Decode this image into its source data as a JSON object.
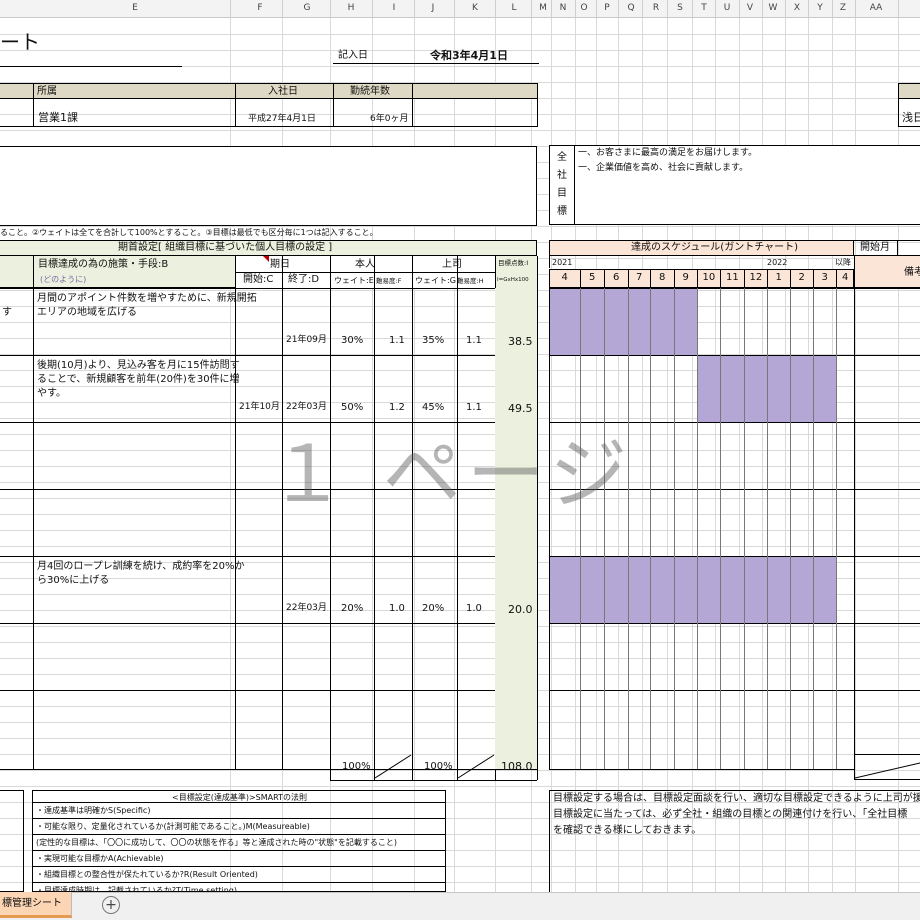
{
  "column_letters": [
    "E",
    "F",
    "G",
    "H",
    "I",
    "J",
    "K",
    "L",
    "M",
    "N",
    "O",
    "P",
    "Q",
    "R",
    "S",
    "T",
    "U",
    "V",
    "W",
    "X",
    "Y",
    "Z",
    "AA"
  ],
  "sheet": {
    "title_fragment": "ート",
    "entry_date_label": "記入日",
    "entry_date_value": "令和3年4月1日",
    "header": {
      "dept_label": "所属",
      "dept_value": "営業1課",
      "joined_label": "入社日",
      "joined_value": "平成27年4月1日",
      "tenure_label": "勤続年数",
      "tenure_value": "6年0ヶ月",
      "right_fragment": "浅日"
    },
    "company_goals": {
      "label_chars": [
        "全",
        "社",
        "目",
        "標"
      ],
      "lines": [
        "一、お客さまに最高の満足をお届けします。",
        "一、企業価値を高め、社会に貢献します。"
      ]
    },
    "notice": "ること。②ウェイトは全てを合計して100%とすること。③目標は最低でも区分毎に1つは記入すること。",
    "period_header": "期首設定[ 組織目標に基づいた個人目標の設定 ]",
    "col_headers": {
      "method": "目標達成の為の施策・手段:B",
      "method_sub": "(どのように)",
      "period": "期日",
      "start": "開始:C",
      "end": "終了:D",
      "self": "本人",
      "self_weight": "ウェイト:E",
      "self_difficulty": "難易度:F",
      "boss": "上司",
      "boss_weight": "ウェイト:G",
      "boss_difficulty": "難易度:H",
      "score": "目標点数:I",
      "score_formula": "I=GxHx100"
    },
    "gantt": {
      "title": "達成のスケジュール(ガントチャート)",
      "year1": "2021",
      "year2": "2022",
      "after_label": "以降",
      "months": [
        "4",
        "5",
        "6",
        "7",
        "8",
        "9",
        "10",
        "11",
        "12",
        "1",
        "2",
        "3",
        "4"
      ],
      "start_month_label": "開始月",
      "remarks_label": "備考"
    },
    "rows": [
      {
        "left_fragment": "す",
        "method": [
          "月間のアポイント件数を増やすために、新規開拓",
          "エリアの地域を広げる"
        ],
        "start": "",
        "end": "21年09月",
        "self_weight": "30%",
        "self_difficulty": "1.1",
        "boss_weight": "35%",
        "boss_difficulty": "1.1",
        "score": "38.5",
        "gantt_months": "4-9"
      },
      {
        "left_fragment": "",
        "method": [
          "後期(10月)より、見込み客を月に15件訪問す",
          "ることで、新規顧客を前年(20件)を30件に増",
          "やす。"
        ],
        "start": "21年10月",
        "end": "22年03月",
        "self_weight": "50%",
        "self_difficulty": "1.2",
        "boss_weight": "45%",
        "boss_difficulty": "1.1",
        "score": "49.5",
        "gantt_months": "10-3"
      },
      {
        "left_fragment": "",
        "method": [],
        "start": "",
        "end": "",
        "self_weight": "",
        "self_difficulty": "",
        "boss_weight": "",
        "boss_difficulty": "",
        "score": "",
        "gantt_months": ""
      },
      {
        "left_fragment": "",
        "method": [],
        "start": "",
        "end": "",
        "self_weight": "",
        "self_difficulty": "",
        "boss_weight": "",
        "boss_difficulty": "",
        "score": "",
        "gantt_months": ""
      },
      {
        "left_fragment": "",
        "method": [
          "月4回のロープレ訓練を続け、成約率を20%か",
          "ら30%に上げる"
        ],
        "start": "",
        "end": "22年03月",
        "self_weight": "20%",
        "self_difficulty": "1.0",
        "boss_weight": "20%",
        "boss_difficulty": "1.0",
        "score": "20.0",
        "gantt_months": "4-3"
      },
      {
        "left_fragment": "",
        "method": [],
        "start": "",
        "end": "",
        "self_weight": "",
        "self_difficulty": "",
        "boss_weight": "",
        "boss_difficulty": "",
        "score": "",
        "gantt_months": ""
      }
    ],
    "totals": {
      "self_weight": "100%",
      "boss_weight": "100%",
      "score": "108.0"
    },
    "smart": {
      "title": "<目標設定(達成基準)>SMARTの法則",
      "items": [
        "・達成基準は明確かS(Specific)",
        "・可能な限り、定量化されているか(計測可能であること。)M(Measureable)",
        "(定性的な目標は、「〇〇に成功して、〇〇の状態を作る」等と達成された時の\"状態\"を記載すること)",
        "・実現可能な目標かA(Achievable)",
        "・組織目標との整合性が保たれているか?R(Result Oriented)",
        "・目標達成時期は、記載されているか?T(Time setting)"
      ]
    },
    "guidance": [
      "目標設定する場合は、目標設定面談を行い、適切な目標設定できるように上司が援助、指",
      "目標設定に当たっては、必ず全社・組織の目標との関連付けを行い、「全社目標",
      "を確認できる様にしておきます。"
    ],
    "watermark": "１ ページ",
    "tabs": {
      "active": "標管理シート",
      "add": "+"
    }
  }
}
